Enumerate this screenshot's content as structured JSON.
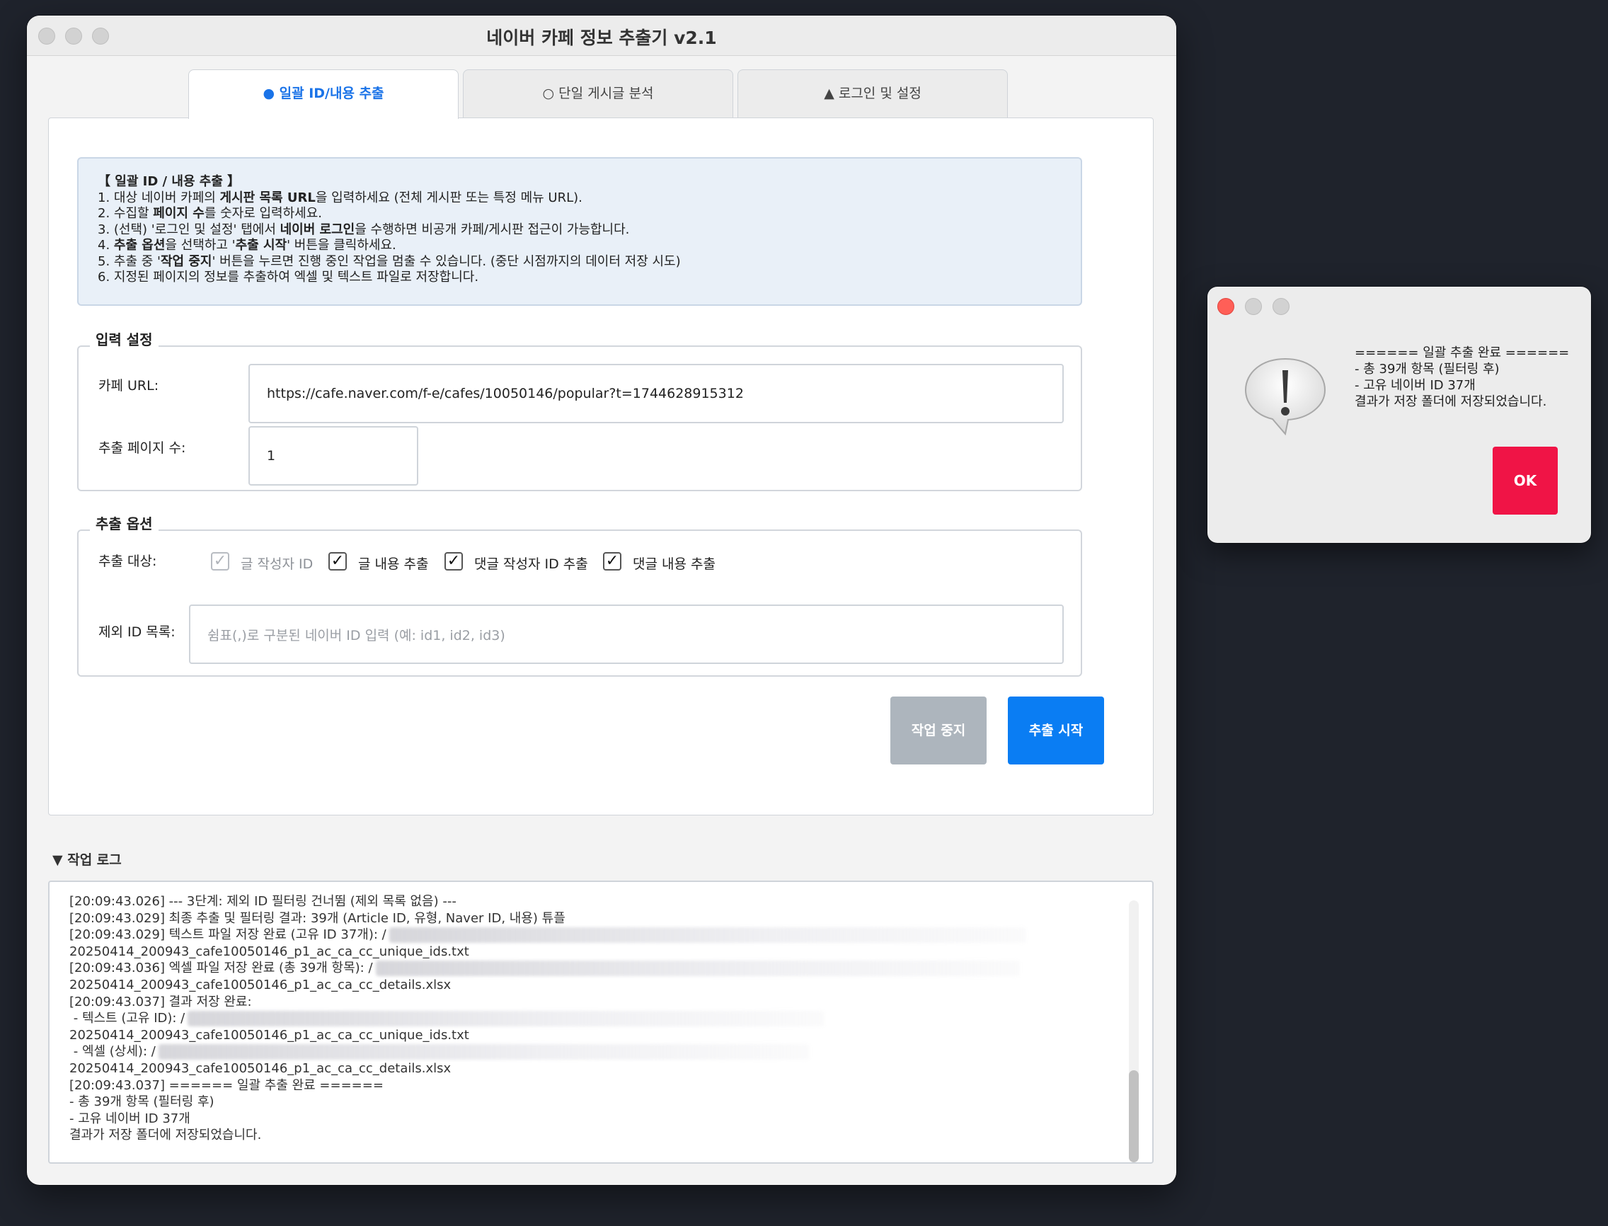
{
  "window": {
    "title": "네이버 카페 정보 추출기 v2.1"
  },
  "tabs": [
    {
      "label": "● 일괄 ID/내용 추출",
      "active": true
    },
    {
      "label": "○ 단일 게시글 분석",
      "active": false
    },
    {
      "label": "▲ 로그인 및 설정",
      "active": false
    }
  ],
  "info": {
    "heading": "【 일괄 ID / 내용 추출 】",
    "line1_a": "1. 대상 네이버 카페의 ",
    "line1_b": "게시판 목록 URL",
    "line1_c": "을 입력하세요 (전체 게시판 또는 특정 메뉴 URL).",
    "line2_a": "2. 수집할 ",
    "line2_b": "페이지 수",
    "line2_c": "를 숫자로 입력하세요.",
    "line3_a": "3. (선택) '로그인 및 설정' 탭에서 ",
    "line3_b": "네이버 로그인",
    "line3_c": "을 수행하면 비공개 카페/게시판 접근이 가능합니다.",
    "line4_a": "4. ",
    "line4_b": "추출 옵션",
    "line4_c": "을 선택하고 '",
    "line4_d": "추출 시작",
    "line4_e": "' 버튼을 클릭하세요.",
    "line5_a": "5. 추출 중 '",
    "line5_b": "작업 중지",
    "line5_c": "' 버튼을 누르면 진행 중인 작업을 멈출 수 있습니다. (중단 시점까지의 데이터 저장 시도)",
    "line6": "6. 지정된 페이지의 정보를 추출하여 엑셀 및 텍스트 파일로 저장합니다."
  },
  "input_settings": {
    "legend": "입력 설정",
    "url_label": "카페 URL:",
    "url_value": "https://cafe.naver.com/f-e/cafes/10050146/popular?t=1744628915312",
    "pages_label": "추출 페이지 수:",
    "pages_value": "1"
  },
  "extract_options": {
    "legend": "추출 옵션",
    "target_label": "추출 대상:",
    "checkboxes": [
      {
        "label": "글 작성자 ID",
        "checked": true,
        "disabled": true
      },
      {
        "label": "글 내용 추출",
        "checked": true,
        "disabled": false
      },
      {
        "label": "댓글 작성자 ID 추출",
        "checked": true,
        "disabled": false
      },
      {
        "label": "댓글 내용 추출",
        "checked": true,
        "disabled": false
      }
    ],
    "exclude_label": "제외 ID 목록:",
    "exclude_placeholder": "쉼표(,)로 구분된 네이버 ID 입력 (예: id1, id2, id3)"
  },
  "buttons": {
    "stop": "작업 중지",
    "start": "추출 시작"
  },
  "colors": {
    "accent": "#1a73e8",
    "start_button": "#0a7df3",
    "stop_button": "#adb5bd",
    "ok_button": "#f01446",
    "close_dot": "#ff5f57"
  },
  "log": {
    "title": "▼ 작업 로그",
    "lines": [
      "[20:09:43.026] --- 3단계: 제외 ID 필터링 건너뜀 (제외 목록 없음) ---",
      "[20:09:43.029] 최종 추출 및 필터링 결과: 39개 (Article ID, 유형, Naver ID, 내용) 튜플",
      "[20:09:43.029] 텍스트 파일 저장 완료 (고유 ID 37개): /",
      "20250414_200943_cafe10050146_p1_ac_ca_cc_unique_ids.txt",
      "[20:09:43.036] 엑셀 파일 저장 완료 (총 39개 항목): /",
      "20250414_200943_cafe10050146_p1_ac_ca_cc_details.xlsx",
      "[20:09:43.037] 결과 저장 완료:",
      " - 텍스트 (고유 ID): /",
      "20250414_200943_cafe10050146_p1_ac_ca_cc_unique_ids.txt",
      " - 엑셀 (상세): /",
      "20250414_200943_cafe10050146_p1_ac_ca_cc_details.xlsx",
      "[20:09:43.037] ====== 일괄 추출 완료 ======",
      "- 총 39개 항목 (필터링 후)",
      "- 고유 네이버 ID 37개",
      "결과가 저장 폴더에 저장되었습니다."
    ]
  },
  "dialog": {
    "icon": "exclamation-speech-bubble-icon",
    "msg_line1": "====== 일괄 추출 완료 ======",
    "msg_line2": "- 총 39개 항목 (필터링 후)",
    "msg_line3": "- 고유 네이버 ID 37개",
    "msg_line4": "결과가 저장 폴더에 저장되었습니다.",
    "ok": "OK"
  }
}
